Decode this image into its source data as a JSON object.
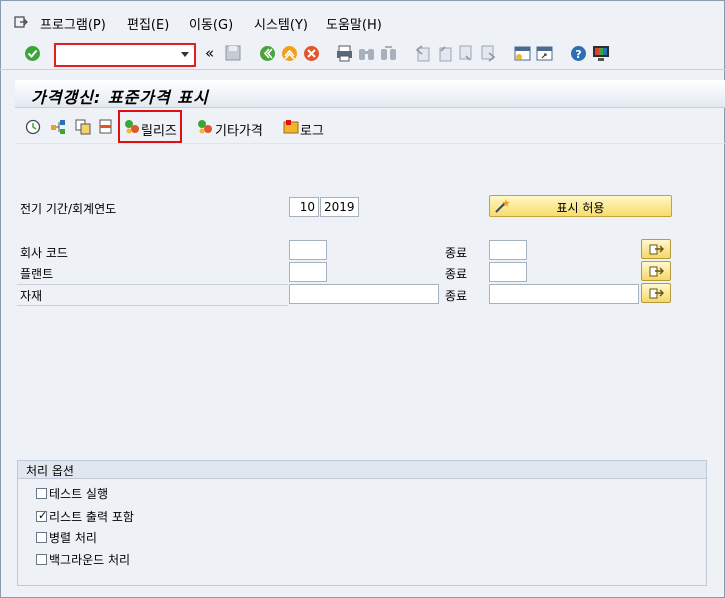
{
  "menu": {
    "items": [
      "프로그램(P)",
      "편집(E)",
      "이동(G)",
      "시스템(Y)",
      "도움말(H)"
    ]
  },
  "toolbar": {
    "command_value": "",
    "double_arrow": "«"
  },
  "title": "가격갱신: 표준가격 표시",
  "app_toolbar": {
    "release_label": "릴리즈",
    "other_price_label": "기타가격",
    "log_label": "로그"
  },
  "form": {
    "period_label": "전기 기간/회계연도",
    "period_value": "10",
    "year_value": "2019",
    "display_allow_label": "표시 허용",
    "company_code_label": "회사 코드",
    "plant_label": "플랜트",
    "material_label": "자재",
    "to_label": "종료"
  },
  "options": {
    "header": "처리 옵션",
    "items": [
      {
        "label": "테스트 실행",
        "checked": false
      },
      {
        "label": "리스트 출력 포함",
        "checked": true
      },
      {
        "label": "병렬 처리",
        "checked": false
      },
      {
        "label": "백그라운드 처리",
        "checked": false
      }
    ]
  },
  "colors": {
    "highlight": "#e01010",
    "accent_yellow": "#f7dd6a"
  }
}
